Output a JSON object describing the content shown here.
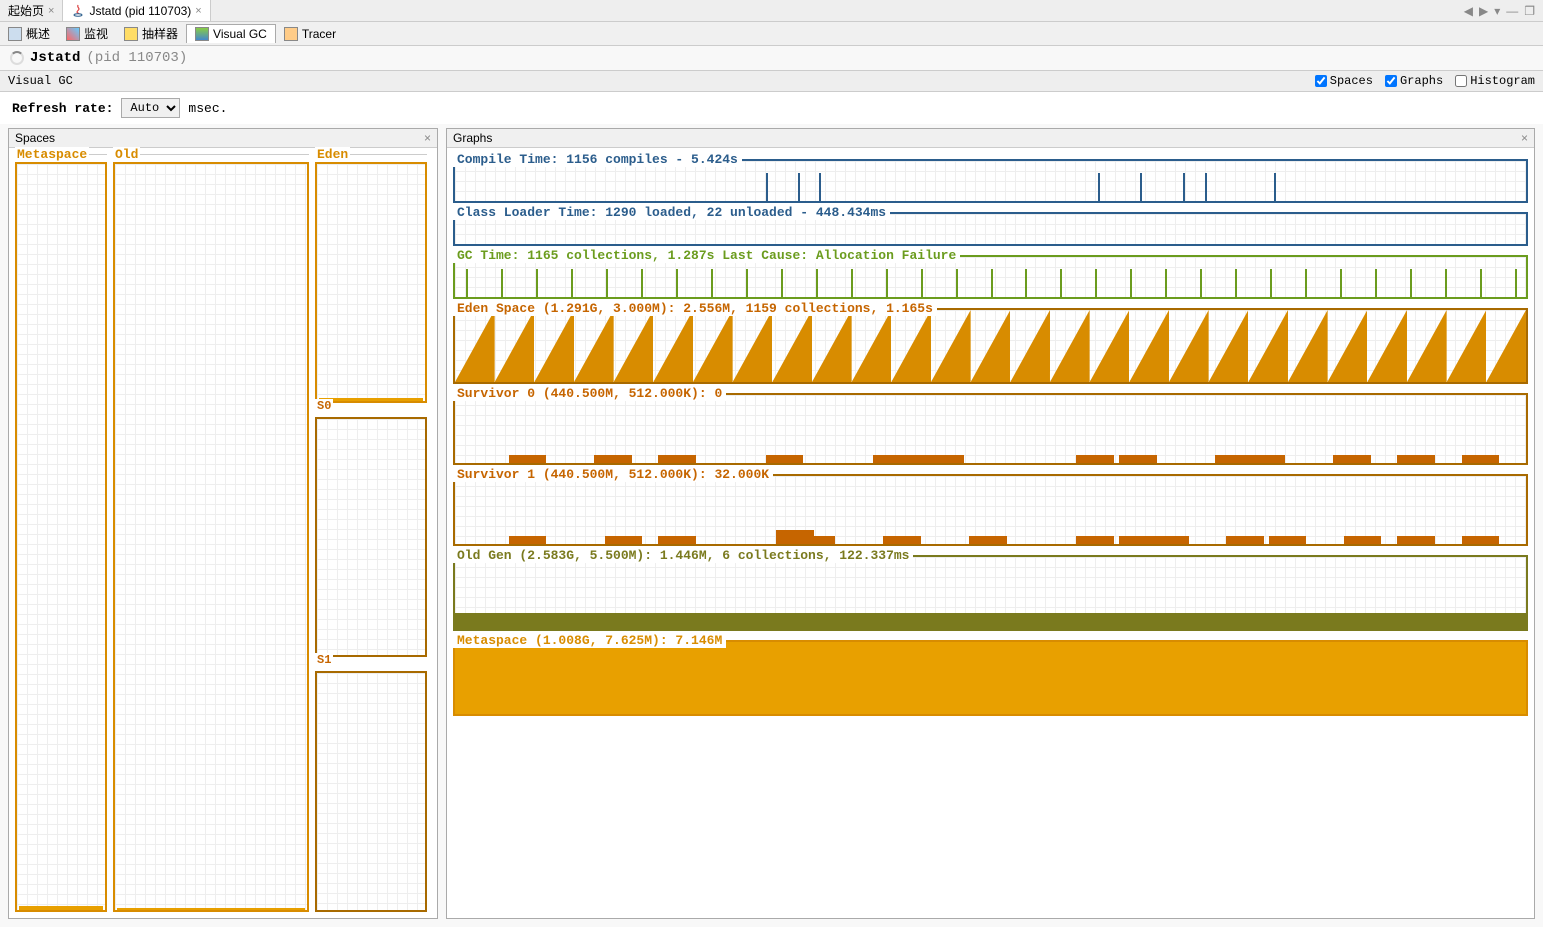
{
  "tabs": {
    "start": "起始页",
    "jstatd": "Jstatd (pid 110703)"
  },
  "window_controls": {
    "left": "◀",
    "right": "▶",
    "menu": "▾",
    "min": "—",
    "max": "❐"
  },
  "toolbar": {
    "overview": "概述",
    "monitor": "监视",
    "sampler": "抽样器",
    "visualgc": "Visual GC",
    "tracer": "Tracer"
  },
  "title": {
    "name": "Jstatd",
    "pid": "(pid 110703)"
  },
  "panel_title": "Visual GC",
  "checkboxes": {
    "spaces": "Spaces",
    "graphs": "Graphs",
    "histogram": "Histogram"
  },
  "refresh": {
    "label": "Refresh rate:",
    "value": "Auto",
    "unit": "msec."
  },
  "panels": {
    "spaces": "Spaces",
    "graphs": "Graphs"
  },
  "spaces": {
    "metaspace": "Metaspace",
    "old": "Old",
    "eden": "Eden",
    "s0": "S0",
    "s1": "S1"
  },
  "graphs": {
    "compile": "Compile Time: 1156 compiles - 5.424s",
    "classloader": "Class Loader Time: 1290 loaded, 22 unloaded - 448.434ms",
    "gc": "GC Time: 1165 collections, 1.287s  Last Cause: Allocation Failure",
    "eden": "Eden Space (1.291G, 3.000M): 2.556M, 1159 collections, 1.165s",
    "s0": "Survivor 0 (440.500M, 512.000K): 0",
    "s1": "Survivor 1 (440.500M, 512.000K): 32.000K",
    "old": "Old Gen (2.583G, 5.500M): 1.446M, 6 collections, 122.337ms",
    "metaspace": "Metaspace (1.008G, 7.625M): 7.146M"
  },
  "chart_data": {
    "compile_time": {
      "type": "spike",
      "title": "Compile Time",
      "compiles": 1156,
      "time_s": 5.424,
      "spikes": [
        29,
        32,
        34,
        60,
        64,
        68,
        70,
        76.5
      ]
    },
    "class_loader": {
      "type": "spike",
      "title": "Class Loader Time",
      "loaded": 1290,
      "unloaded": 22,
      "time_ms": 448.434,
      "spikes": []
    },
    "gc_time": {
      "type": "spike",
      "title": "GC Time",
      "collections": 1165,
      "time_s": 1.287,
      "last_cause": "Allocation Failure",
      "spikes_uniform": 31
    },
    "eden": {
      "type": "sawtooth",
      "title": "Eden Space",
      "max": "1.291G",
      "capacity": "3.000M",
      "used": "2.556M",
      "collections": 1159,
      "time_s": 1.165,
      "teeth": 27
    },
    "survivor0": {
      "type": "blocks",
      "title": "Survivor 0",
      "max": "440.500M",
      "capacity": "512.000K",
      "used": 0,
      "blocks": [
        5,
        13,
        19,
        29,
        39,
        42,
        44,
        58,
        62,
        71,
        74,
        82,
        88,
        94
      ]
    },
    "survivor1": {
      "type": "blocks",
      "title": "Survivor 1",
      "max": "440.500M",
      "capacity": "512.000K",
      "used": "32.000K",
      "blocks": [
        5,
        14,
        19,
        30,
        32,
        40,
        48,
        58,
        62,
        65,
        72,
        76,
        83,
        88,
        94
      ]
    },
    "old_gen": {
      "type": "area",
      "title": "Old Gen",
      "max": "2.583G",
      "capacity": "5.500M",
      "used": "1.446M",
      "collections": 6,
      "time_ms": 122.337,
      "fill_pct": 22
    },
    "metaspace": {
      "type": "area",
      "title": "Metaspace",
      "max": "1.008G",
      "capacity": "7.625M",
      "used": "7.146M",
      "fill_pct": 94
    }
  }
}
